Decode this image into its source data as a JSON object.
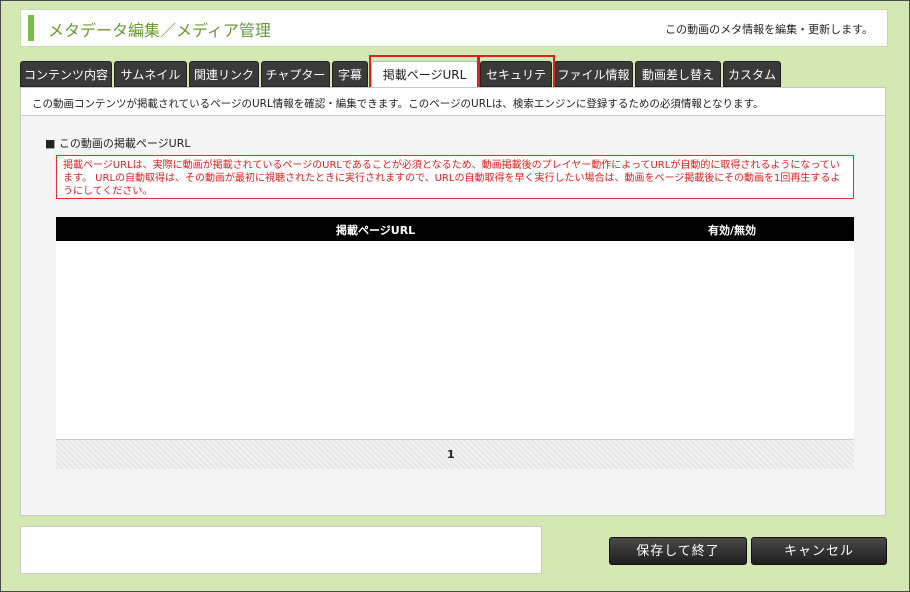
{
  "header": {
    "title": "メタデータ編集／メディア管理",
    "description": "この動画のメタ情報を編集・更新します。"
  },
  "tabs": [
    {
      "label": "コンテンツ内容"
    },
    {
      "label": "サムネイル"
    },
    {
      "label": "関連リンク"
    },
    {
      "label": "チャプター"
    },
    {
      "label": "字幕"
    },
    {
      "label": "掲載ページURL"
    },
    {
      "label": "セキュリティ"
    },
    {
      "label": "ファイル情報"
    },
    {
      "label": "動画差し替え"
    },
    {
      "label": "カスタム"
    }
  ],
  "active_tab": "掲載ページURL",
  "panel": {
    "intro": "この動画コンテンツが掲載されているページのURL情報を確認・編集できます。このページのURLは、検索エンジンに登録するための必須情報となります。",
    "section_title": "■ この動画の掲載ページURL",
    "warning": "掲載ページURLは、実際に動画が掲載されているページのURLであることが必須となるため、動画掲載後のプレイヤー動作によってURLが自動的に取得されるようになっています。 URLの自動取得は、その動画が最初に視聴されたときに実行されますので、URLの自動取得を早く実行したい場合は、動画をページ掲載後にその動画を1回再生するようにしてください。",
    "table": {
      "col_url": "掲載ページURL",
      "col_status": "有効/無効",
      "page": "1"
    }
  },
  "buttons": {
    "save": "保存して終了",
    "cancel": "キャンセル"
  },
  "colors": {
    "background": "#d4e8b4",
    "accent": "#7ac143",
    "highlight": "#e02020"
  }
}
